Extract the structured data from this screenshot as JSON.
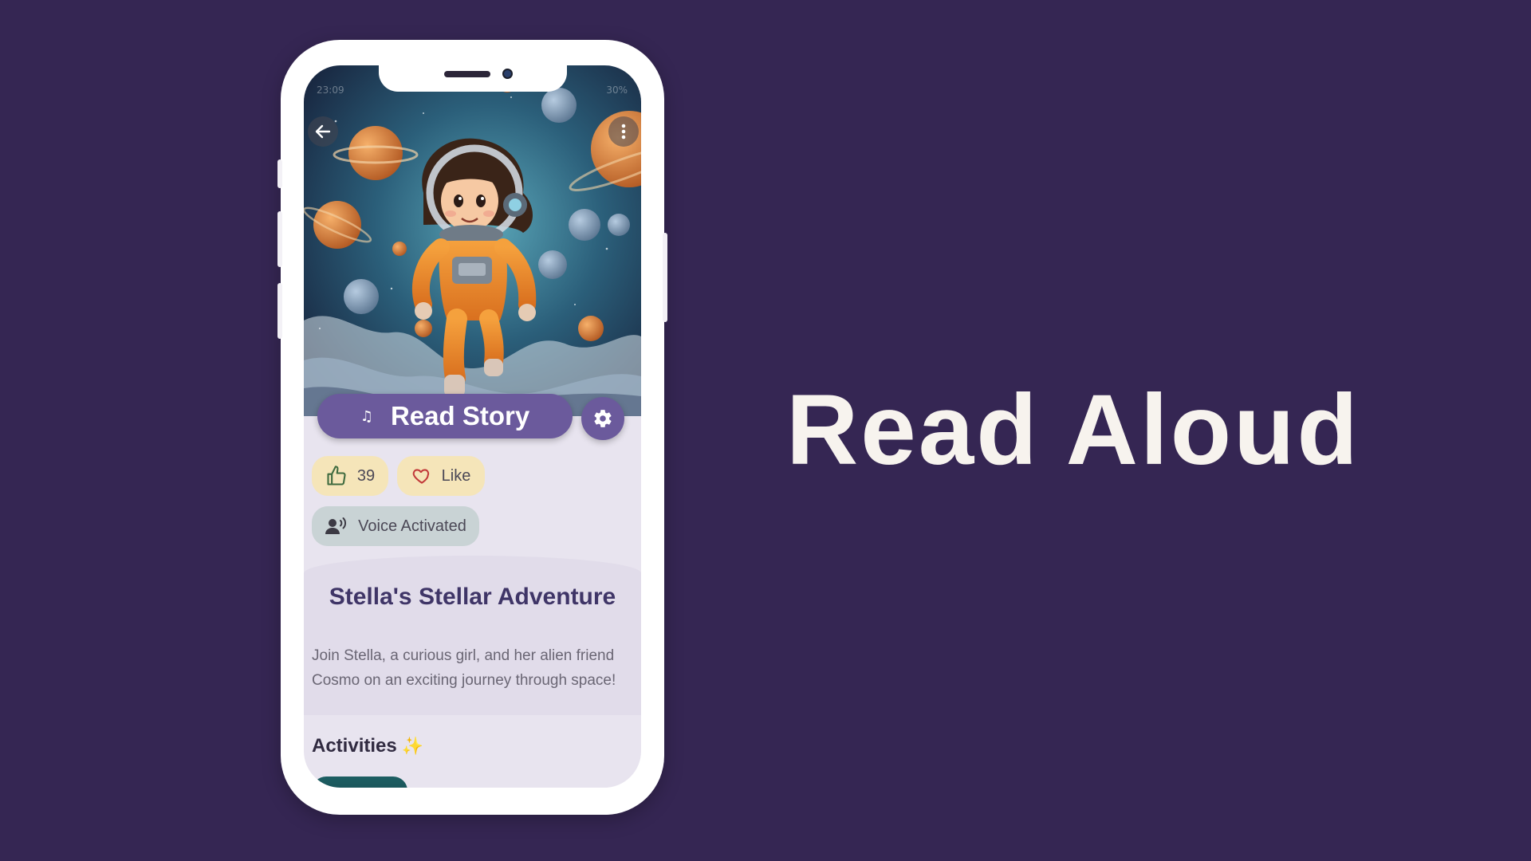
{
  "status_bar": {
    "time": "23:09",
    "right": "30%"
  },
  "hero": {
    "back_icon": "arrow-left-icon",
    "menu_icon": "kebab-menu-icon"
  },
  "read_button": {
    "icon": "music-note-icon",
    "note_glyph": "♫",
    "label": "Read Story"
  },
  "settings_button": {
    "icon": "gear-icon"
  },
  "reactions": {
    "thumbs_count": "39",
    "like_label": "Like"
  },
  "voice": {
    "label": "Voice Activated"
  },
  "story": {
    "title": "Stella's Stellar Adventure",
    "description": "Join Stella, a curious girl, and her alien friend Cosmo on an exciting journey through space!"
  },
  "activities": {
    "heading": "Activities",
    "sparkle": "✨"
  },
  "feature_title": "Read Aloud",
  "colors": {
    "background": "#352653",
    "accent": "#6b5a9c",
    "like_pill": "#f5e5b9",
    "voice_pill": "#c9d3d5",
    "title_text": "#3f3567",
    "big_title": "#f7f3ee"
  }
}
